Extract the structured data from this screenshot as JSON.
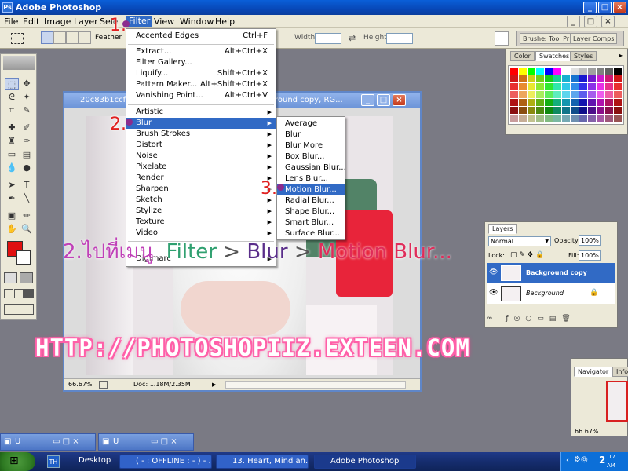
{
  "app": {
    "title": "Adobe Photoshop"
  },
  "menubar": [
    "File",
    "Edit",
    "Image",
    "Layer",
    "Sele",
    "Filter",
    "View",
    "Window",
    "Help"
  ],
  "options": {
    "feather_label": "Feather",
    "width_label": "Width:",
    "height_label": "Height:"
  },
  "palette_well": [
    "Brushes",
    "Tool Pr",
    "Layer Comps"
  ],
  "document": {
    "title": "20c83b1ccfc...",
    "title_suffix": "round copy, RG...",
    "zoom": "66.67%",
    "doc_size": "Doc: 1.18M/2.35M"
  },
  "filter_menu": {
    "top_items": [
      {
        "label": "Accented Edges",
        "shortcut": "Ctrl+F"
      }
    ],
    "group2": [
      {
        "label": "Extract...",
        "shortcut": "Alt+Ctrl+X"
      },
      {
        "label": "Filter Gallery...",
        "shortcut": ""
      },
      {
        "label": "Liquify...",
        "shortcut": "Shift+Ctrl+X"
      },
      {
        "label": "Pattern Maker...",
        "shortcut": "Alt+Shift+Ctrl+X"
      },
      {
        "label": "Vanishing Point...",
        "shortcut": "Alt+Ctrl+V"
      }
    ],
    "group3": [
      "Artistic",
      "Blur",
      "Brush Strokes",
      "Distort",
      "Noise",
      "Pixelate",
      "Render",
      "Sharpen",
      "Sketch",
      "Stylize",
      "Texture",
      "Video",
      "Digimarc"
    ]
  },
  "blur_menu": [
    "Average",
    "Blur",
    "Blur More",
    "Box Blur...",
    "Gaussian Blur...",
    "Lens Blur...",
    "Motion Blur...",
    "Radial Blur...",
    "Shape Blur...",
    "Smart Blur...",
    "Surface Blur..."
  ],
  "swatches_panel": {
    "tabs": [
      "Color",
      "Swatches",
      "Styles"
    ]
  },
  "layers_panel": {
    "tab": "Layers",
    "blend_mode": "Normal",
    "opacity_label": "Opacity:",
    "opacity": "100%",
    "lock_label": "Lock:",
    "fill_label": "Fill:",
    "fill": "100%",
    "layers": [
      {
        "name": "Background copy"
      },
      {
        "name": "Background"
      }
    ]
  },
  "navigator_panel": {
    "tabs": [
      "Navigator",
      "Info"
    ],
    "zoom": "66.67%"
  },
  "annotations": {
    "step1": "1.",
    "step2": "2.",
    "step3": "3.",
    "instruction_thai": "2.ไปที่เมนู",
    "instruction_filter": "Filter",
    "instruction_gt1": " > ",
    "instruction_blur": "Blur",
    "instruction_gt2": " > ",
    "instruction_motion": "Motion Blur...",
    "url": "HTTP://PHOTOSHOPIIZ.EXTEEN.COM"
  },
  "minimized_windows": [
    "U",
    "U"
  ],
  "taskbar": {
    "quicklaunch": "TH",
    "buttons": [
      "Desktop",
      "( - : OFFLINE : - ) - ...",
      "13. Heart, Mind an...",
      "Adobe Photoshop"
    ],
    "time_top": "2",
    "time_ampm": "AM",
    "time_min": "17"
  },
  "colors": {
    "foreground": "#e01010",
    "background": "#ffffff",
    "menu_selection": "#316ac5",
    "annotation_red": "#e02020",
    "annotation_purple": "#8b2c8e",
    "url_pink": "#ff5fa8"
  }
}
